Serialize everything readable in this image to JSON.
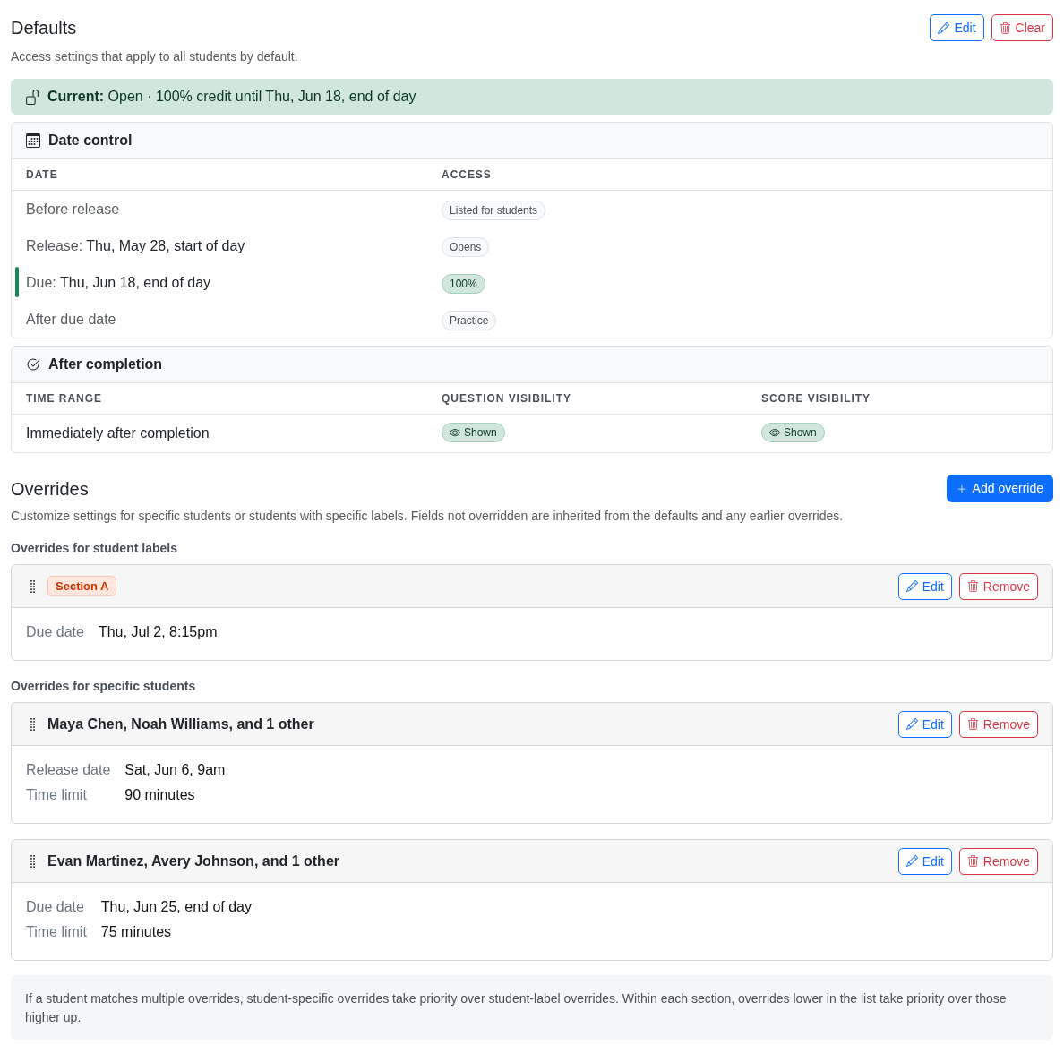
{
  "defaults": {
    "title": "Defaults",
    "description": "Access settings that apply to all students by default.",
    "buttons": [
      {
        "kind": "edit",
        "label": "Edit"
      },
      {
        "kind": "clear",
        "label": "Clear"
      }
    ]
  },
  "current_banner": {
    "text": "**Current:** Open · 100% credit until Thu, Jun 18, end of day"
  },
  "date_control": {
    "title": "Date control",
    "columns": [
      "DATE",
      "ACCESS"
    ],
    "rows": [
      {
        "label": "Before release",
        "access": {
          "text": "Listed for students",
          "kind": "neutral"
        },
        "current": false
      },
      {
        "label": "Release:",
        "date": "Thu, May 28, start of day",
        "access": {
          "text": "Opens",
          "kind": "neutral"
        },
        "current": false
      },
      {
        "label": "Due:",
        "date": "Thu, Jun 18, end of day",
        "access": {
          "text": "100%",
          "kind": "success"
        },
        "current": true
      },
      {
        "label": "After due date",
        "access": {
          "text": "Practice",
          "kind": "neutral"
        },
        "current": false
      }
    ]
  },
  "after_completion": {
    "title": "After completion",
    "columns": [
      "TIME RANGE",
      "QUESTION VISIBILITY",
      "SCORE VISIBILITY"
    ],
    "rows": [
      {
        "time_range": "Immediately after completion",
        "question_visibility": {
          "text": "Shown",
          "kind": "success"
        },
        "score_visibility": {
          "text": "Shown",
          "kind": "success"
        }
      }
    ]
  },
  "overrides": {
    "title": "Overrides",
    "description": "Customize settings for specific students or students with specific labels. Fields not overridden are inherited from the defaults and any earlier overrides.",
    "add_button": "Add override",
    "groups": [
      {
        "title": "Overrides for student labels",
        "items": [
          {
            "kind": "label",
            "title": "Section A",
            "buttons": [
              {
                "kind": "edit",
                "label": "Edit"
              },
              {
                "kind": "remove",
                "label": "Remove"
              }
            ],
            "fields": [
              {
                "label": "Due date",
                "value": "Thu, Jul 2, 8:15pm"
              }
            ]
          }
        ]
      },
      {
        "title": "Overrides for specific students",
        "items": [
          {
            "kind": "students",
            "title": "Maya Chen, Noah Williams, and 1 other",
            "buttons": [
              {
                "kind": "edit",
                "label": "Edit"
              },
              {
                "kind": "remove",
                "label": "Remove"
              }
            ],
            "fields": [
              {
                "label": "Release date",
                "value": "Sat, Jun 6, 9am"
              },
              {
                "label": "Time limit",
                "value": "90 minutes"
              }
            ]
          },
          {
            "kind": "students",
            "title": "Evan Martinez, Avery Johnson, and 1 other",
            "buttons": [
              {
                "kind": "edit",
                "label": "Edit"
              },
              {
                "kind": "remove",
                "label": "Remove"
              }
            ],
            "fields": [
              {
                "label": "Due date",
                "value": "Thu, Jun 25, end of day"
              },
              {
                "label": "Time limit",
                "value": "75 minutes"
              }
            ]
          }
        ]
      }
    ]
  },
  "note": "If a student matches multiple overrides, student-specific overrides take priority over student-label overrides. Within each section, overrides lower in the list take priority over those higher up."
}
